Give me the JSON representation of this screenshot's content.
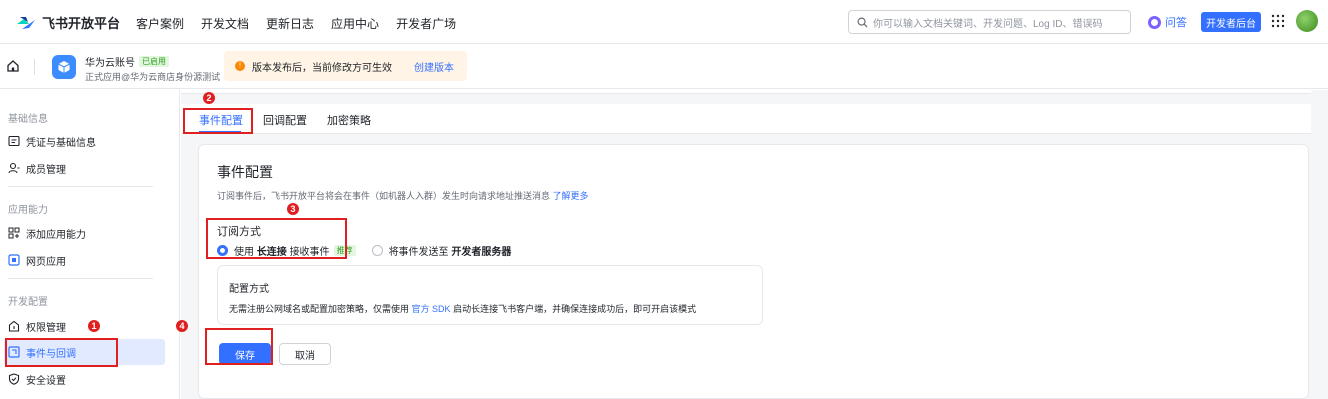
{
  "topnav": {
    "brand": "飞书开放平台",
    "links": [
      "客户案例",
      "开发文档",
      "更新日志",
      "应用中心",
      "开发者广场"
    ],
    "search_placeholder": "你可以输入文档关键词、开发问题、Log ID、错误码",
    "ask_label": "问答",
    "dev_console_label": "开发者后台"
  },
  "appbar": {
    "app_name": "华为云账号",
    "app_status": "已启用",
    "app_subtitle": "正式应用@华为云商店身份源测试",
    "notice_icon": "!",
    "notice_text": "版本发布后，当前修改方可生效",
    "notice_link": "创建版本"
  },
  "sidebar": {
    "groups": [
      {
        "label": "基础信息",
        "items": [
          "凭证与基础信息",
          "成员管理"
        ]
      },
      {
        "label": "应用能力",
        "items": [
          "添加应用能力",
          "网页应用"
        ]
      },
      {
        "label": "开发配置",
        "items": [
          "权限管理",
          "事件与回调",
          "安全设置"
        ]
      }
    ],
    "active_item": "事件与回调"
  },
  "tabs": {
    "items": [
      "事件配置",
      "回调配置",
      "加密策略"
    ],
    "active": "事件配置"
  },
  "card": {
    "title": "事件配置",
    "desc": "订阅事件后，飞书开放平台将会在事件（如机器人入群）发生时向请求地址推送消息",
    "desc_link": "了解更多",
    "subscribe_label": "订阅方式",
    "option1_prefix": "使用",
    "option1_bold": "长连接",
    "option1_suffix": "接收事件",
    "option1_badge": "推荐",
    "option2_prefix": "将事件发送至",
    "option2_bold": "开发者服务器",
    "config_title": "配置方式",
    "config_desc_prefix": "无需注册公网域名或配置加密策略，仅需使用",
    "config_desc_link": "官方 SDK",
    "config_desc_suffix": "启动长连接飞书客户端，并确保连接成功后，即可开启该模式",
    "save_label": "保存",
    "cancel_label": "取消"
  },
  "annotations": [
    "1",
    "2",
    "3",
    "4"
  ],
  "colors": {
    "accent": "#3370ff",
    "annotation": "#e02020",
    "badge_green": "#2ea121"
  }
}
